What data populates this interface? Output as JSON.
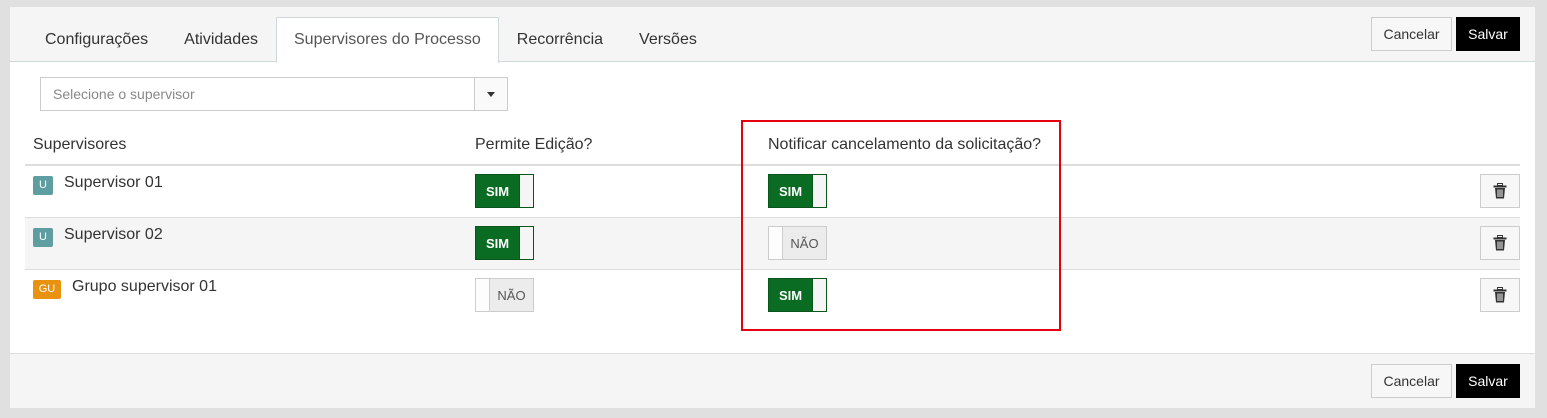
{
  "tabs": [
    {
      "label": "Configurações",
      "active": false
    },
    {
      "label": "Atividades",
      "active": false
    },
    {
      "label": "Supervisores do Processo",
      "active": true
    },
    {
      "label": "Recorrência",
      "active": false
    },
    {
      "label": "Versões",
      "active": false
    }
  ],
  "actions": {
    "cancel_label": "Cancelar",
    "save_label": "Salvar"
  },
  "supervisor_select": {
    "placeholder": "Selecione o supervisor",
    "icon": "caret-down-icon"
  },
  "table": {
    "headers": {
      "supervisors": "Supervisores",
      "allow_edit": "Permite Edição?",
      "notify_cancel": "Notificar cancelamento da solicitação?"
    },
    "rows": [
      {
        "badge": "U",
        "badge_type": "user",
        "name": "Supervisor 01",
        "allow_edit": true,
        "allow_edit_label": "SIM",
        "notify_cancel": true,
        "notify_cancel_label": "SIM"
      },
      {
        "badge": "U",
        "badge_type": "user",
        "name": "Supervisor 02",
        "allow_edit": true,
        "allow_edit_label": "SIM",
        "notify_cancel": false,
        "notify_cancel_label": "NÃO"
      },
      {
        "badge": "GU",
        "badge_type": "group",
        "name": "Grupo supervisor 01",
        "allow_edit": false,
        "allow_edit_label": "NÃO",
        "notify_cancel": true,
        "notify_cancel_label": "SIM"
      }
    ]
  },
  "colors": {
    "toggle_on": "#0a6b22",
    "badge_user": "#5f9ea0",
    "badge_group": "#e8920f",
    "highlight": "#e3000f",
    "save_button": "#000000"
  }
}
